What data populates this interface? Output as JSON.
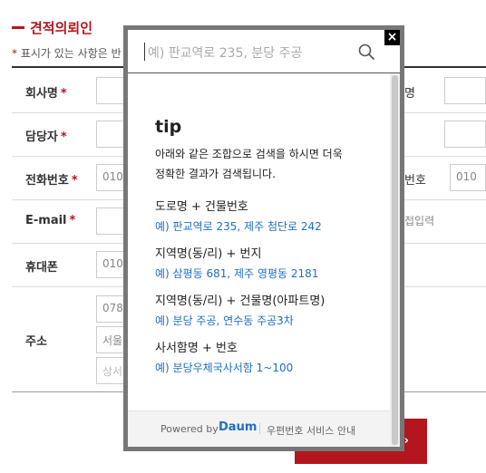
{
  "form": {
    "section_title": "견적의뢰인",
    "notice_star": "*",
    "notice_text": "표시가 있는 사항은 반",
    "required_mark": "*",
    "rows": {
      "company": {
        "label": "회사명"
      },
      "manager": {
        "label": "담당자"
      },
      "phone": {
        "label": "전화번호",
        "value": "010",
        "right_label": "번호",
        "right_value": "010"
      },
      "email": {
        "label": "E-mail",
        "right_hint": "접입력"
      },
      "mobile": {
        "label": "휴대폰",
        "value": "010"
      },
      "address": {
        "label": "주소",
        "postcode": "078",
        "address1": "서울",
        "address2_placeholder": "상서"
      }
    },
    "right_label_top": "명",
    "submit_arrow": "›"
  },
  "popup": {
    "search_placeholder": "예) 판교역로 235, 분당 주공",
    "close_label": "×",
    "tip_title": "tip",
    "tip_desc_line1": "아래와 같은 조합으로 검색을 하시면 더욱",
    "tip_desc_line2": "정확한 결과가 검색됩니다.",
    "examples": [
      {
        "head": "도로명 + 건물번호",
        "value": "예) 판교역로 235,  제주 첨단로 242"
      },
      {
        "head": "지역명(동/리) + 번지",
        "value": "예) 삼평동 681,  제주 영평동 2181"
      },
      {
        "head": "지역명(동/리) + 건물명(아파트명)",
        "value": "예) 분당 주공,  연수동 주공3차"
      },
      {
        "head": "사서함명 + 번호",
        "value": "예) 분당우체국사서함 1~100"
      }
    ],
    "footer": {
      "powered_by": "Powered by",
      "logo": "Daum",
      "guide": "우편번호 서비스 안내"
    }
  },
  "colors": {
    "accent": "#b3161d",
    "link": "#1e6fc4"
  }
}
